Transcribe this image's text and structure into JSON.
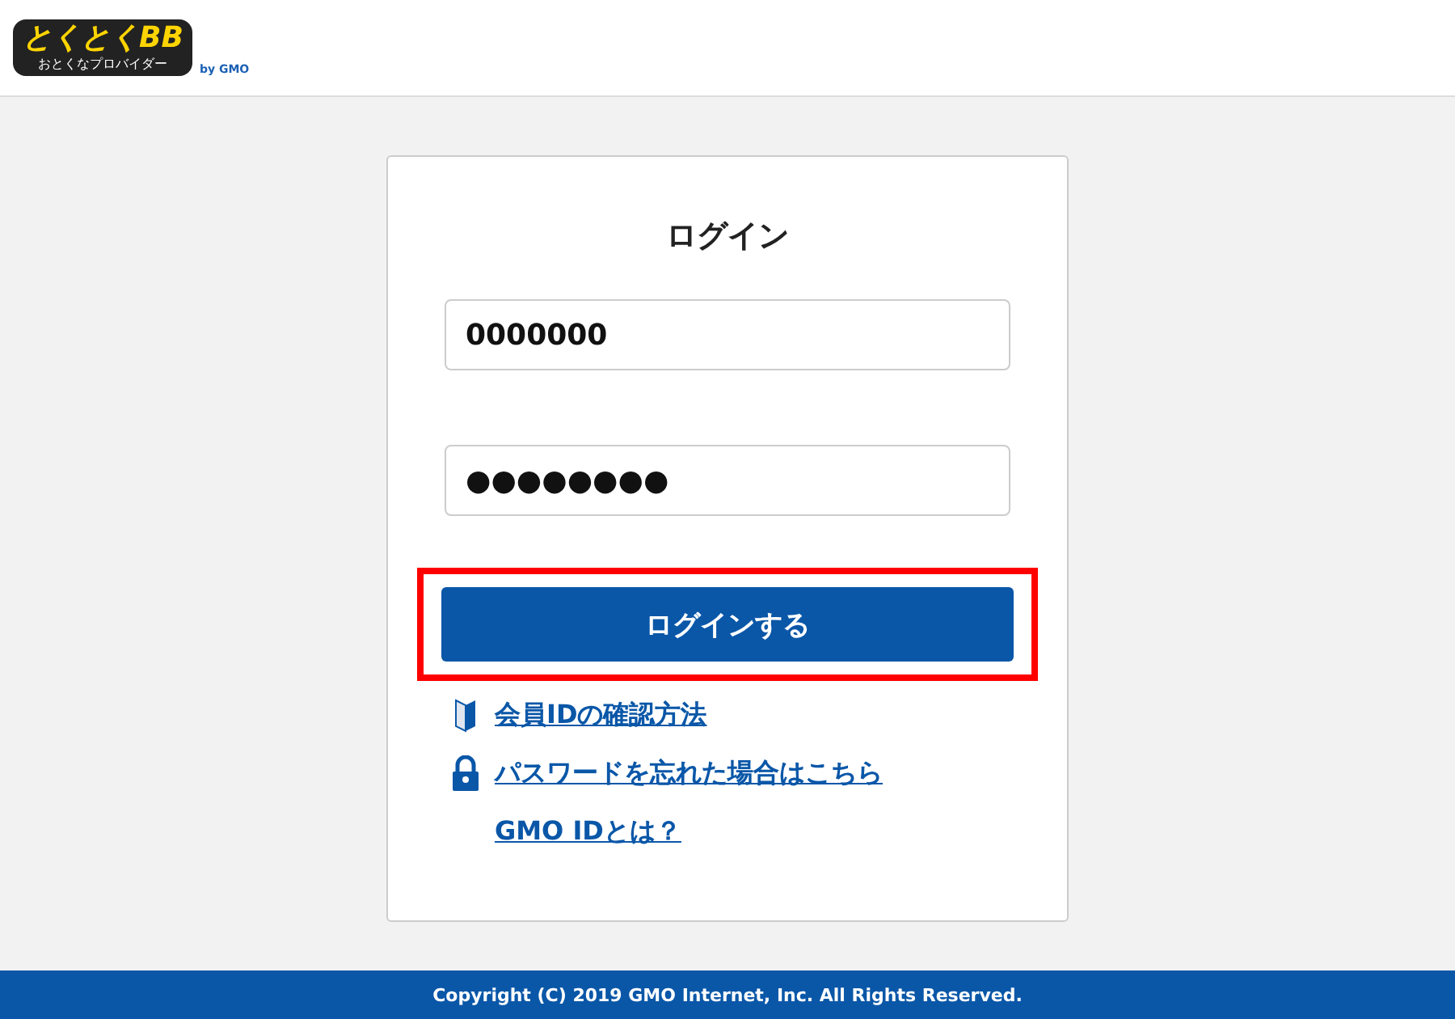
{
  "header": {
    "logo": {
      "title": "とくとくBB",
      "tagline": "おとくなプロバイダー",
      "by": "by GMO"
    }
  },
  "login": {
    "title": "ログイン",
    "id_field": {
      "value": "0000000"
    },
    "password_field": {
      "value": "●●●●●●●●"
    },
    "submit": {
      "label": "ログインする",
      "highlighted": true
    },
    "links": [
      {
        "kind": "book",
        "label": "会員IDの確認方法"
      },
      {
        "kind": "lock",
        "label": "パスワードを忘れた場合はこちら"
      },
      {
        "kind": "none",
        "label": "GMO IDとは？"
      }
    ]
  },
  "footer": {
    "copyright": "Copyright (C) 2019 GMO Internet, Inc. All Rights Reserved."
  }
}
